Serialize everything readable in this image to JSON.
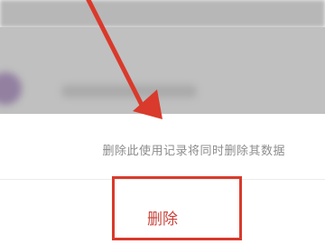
{
  "dialog": {
    "message": "删除此使用记录将同时删除其数据",
    "delete_label": "删除"
  },
  "colors": {
    "annotation": "#d93a2b",
    "delete_text": "#c8453c",
    "message_text": "#8c8c8c"
  },
  "icons": {
    "annotation": "red-arrow-icon"
  }
}
